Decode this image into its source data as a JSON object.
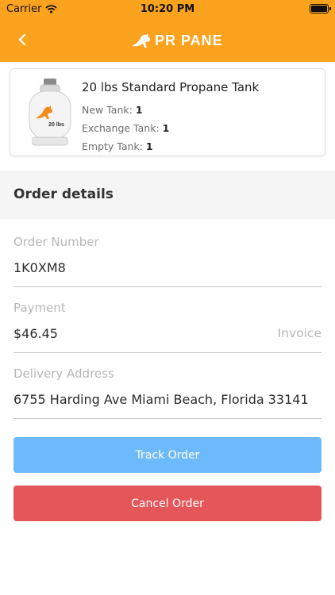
{
  "status_bar": {
    "carrier": "Carrier",
    "time": "10:20 PM"
  },
  "header": {
    "logo_text": "PR PANE",
    "back_icon": "chevron-left-icon"
  },
  "product": {
    "title": "20 lbs Standard Propane Tank",
    "tank_label": "20 lbs",
    "new_tank_label": "New Tank:",
    "new_tank_value": "1",
    "exchange_tank_label": "Exchange Tank:",
    "exchange_tank_value": "1",
    "empty_tank_label": "Empty Tank:",
    "empty_tank_value": "1"
  },
  "order_details": {
    "section_title": "Order details",
    "order_number_label": "Order Number",
    "order_number": "1K0XM8",
    "payment_label": "Payment",
    "payment_amount": "$46.45",
    "payment_link": "Invoice",
    "delivery_label": "Delivery Address",
    "delivery_address": "6755 Harding Ave Miami Beach, Florida 33141"
  },
  "actions": {
    "track_label": "Track Order",
    "cancel_label": "Cancel Order"
  },
  "colors": {
    "brand_orange": "#fba21e",
    "track_blue": "#6cbafc",
    "cancel_red": "#e45658"
  }
}
